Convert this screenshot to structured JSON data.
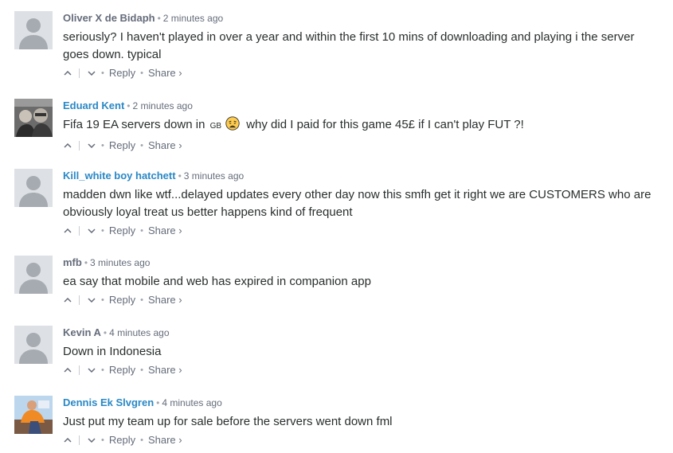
{
  "comments": [
    {
      "author": "Oliver X de Bidaph",
      "time": "2 minutes ago",
      "text": "seriously? I haven't played in over a year and within the first 10 mins of downloading and playing i the server goes down. typical",
      "reply": "Reply",
      "share": "Share ›"
    },
    {
      "author": "Eduard Kent",
      "time": "2 minutes ago",
      "text_before": "Fifa 19 EA servers down in",
      "flag": "GB",
      "emoji": "weary-face-emoji",
      "text_after": "why did I paid for this game 45£ if I can't play FUT ?!",
      "reply": "Reply",
      "share": "Share ›"
    },
    {
      "author": "Kill_white boy hatchett",
      "time": "3 minutes ago",
      "text": "madden dwn like wtf...delayed updates every other day now this smfh get it right we are CUSTOMERS who are obviously loyal treat us better happens kind of frequent",
      "reply": "Reply",
      "share": "Share ›"
    },
    {
      "author": "mfb",
      "time": "3 minutes ago",
      "text": "ea say that mobile and web has expired in companion app",
      "reply": "Reply",
      "share": "Share ›"
    },
    {
      "author": "Kevin A",
      "time": "4 minutes ago",
      "text": "Down in Indonesia",
      "reply": "Reply",
      "share": "Share ›"
    },
    {
      "author": "Dennis Ek Slvgren",
      "time": "4 minutes ago",
      "text": "Just put my team up for sale before the servers went down fml",
      "reply": "Reply",
      "share": "Share ›"
    }
  ],
  "separator": "•",
  "colors": {
    "author_gray": "#656c7a",
    "author_blue": "#2a88c5",
    "text": "#2a2e2e",
    "meta": "#656c7a"
  }
}
